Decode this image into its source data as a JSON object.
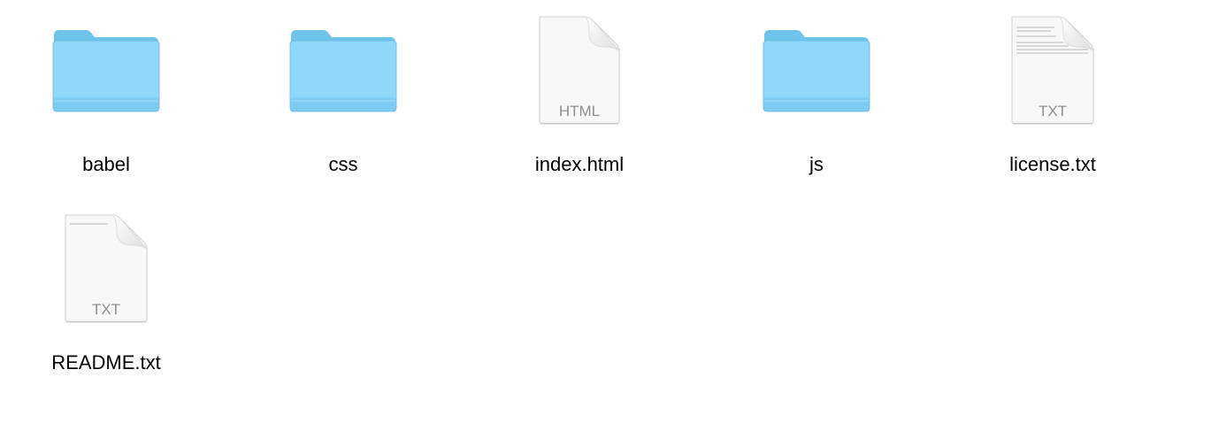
{
  "colors": {
    "folder_back": "#6fc4ec",
    "folder_front_top": "#8fd8fa",
    "folder_front_bottom": "#7fcdf4",
    "folder_edge": "#62b6e2",
    "document_fill": "#f7f7f7",
    "document_stroke": "#d0d0d0",
    "badge_text": "#8e8e8e"
  },
  "items": [
    {
      "name": "babel",
      "kind": "folder",
      "icon": "folder-icon"
    },
    {
      "name": "css",
      "kind": "folder",
      "icon": "folder-icon"
    },
    {
      "name": "index.html",
      "kind": "document",
      "badge": "HTML",
      "icon": "html-document-icon"
    },
    {
      "name": "js",
      "kind": "folder",
      "icon": "folder-icon"
    },
    {
      "name": "license.txt",
      "kind": "document",
      "badge": "TXT",
      "icon": "text-document-icon"
    },
    {
      "name": "README.txt",
      "kind": "document",
      "badge": "TXT",
      "icon": "text-document-icon"
    }
  ]
}
